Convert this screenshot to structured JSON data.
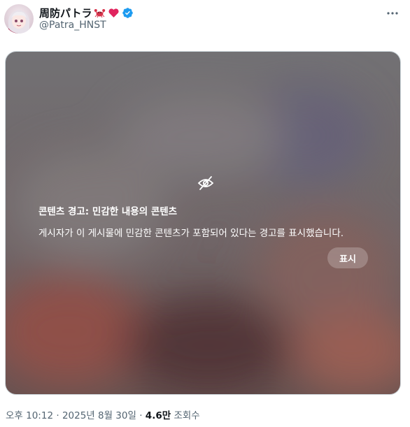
{
  "author": {
    "display_name": "周防パトラ",
    "handle": "@Patra_HNST",
    "emojis": [
      "crab-emoji",
      "red-heart-emoji"
    ],
    "verified": true,
    "verified_color": "#1d9bf0"
  },
  "more_icon": "more-horizontal-icon",
  "content_warning": {
    "icon": "eye-slash-icon",
    "title": "콘텐츠 경고: 민감한 내용의 콘텐츠",
    "description": "게시자가 이 게시물에 민감한 콘텐츠가 포함되어 있다는 경고를 표시했습니다.",
    "show_label": "표시"
  },
  "meta": {
    "time": "오후 10:12",
    "date": "2025년 8월 30일",
    "separator": "·",
    "views_count": "4.6만",
    "views_label": "조회수"
  },
  "colors": {
    "text_primary": "#0f1419",
    "text_secondary": "#536471",
    "verified_blue": "#1d9bf0",
    "heart_red": "#e0245e"
  }
}
